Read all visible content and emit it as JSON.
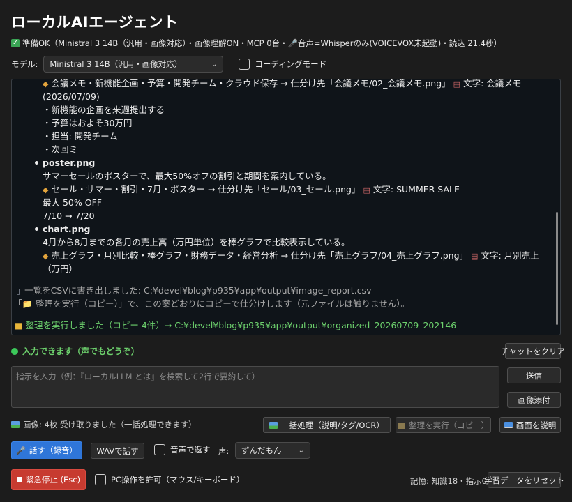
{
  "app": {
    "title": "ローカルAIエージェント",
    "status_text": "準備OK（Ministral 3 14B（汎用・画像対応）・画像理解ON・MCP 0台・🎤音声=Whisperのみ(VOICEVOX未起動)・読込 21.4秒）"
  },
  "model": {
    "label": "モデル:",
    "selected": "Ministral 3 14B（汎用・画像対応）",
    "coding_mode_label": "コーディングモード"
  },
  "chat": {
    "lines": [
      "会議メモ・新機能企画・予算・開発チーム・クラウド保存 → 仕分け先「会議メモ/02_会議メモ.png」",
      "文字: 会議メモ",
      "(2026/07/09)",
      "・新機能の企画を来週提出する",
      "・予算はおよそ30万円",
      "・担当: 開発チーム",
      "・次回ミ",
      "poster.png",
      "サマーセールのポスターで、最大50%オフの割引と期間を案内している。",
      "セール・サマー・割引・7月・ポスター → 仕分け先「セール/03_セール.png」",
      "文字: SUMMER SALE",
      "最大 50% OFF",
      "7/10 → 7/20",
      "chart.png",
      "4月から8月までの各月の売上高（万円単位）を棒グラフで比較表示している。",
      "売上グラフ・月別比較・棒グラフ・財務データ・経営分析 → 仕分け先「売上グラフ/04_売上グラフ.png」",
      "文字: 月別売上",
      "（万円）",
      "一覧をCSVに書き出しました: C:¥devel¥blog¥p935¥app¥output¥image_report.csv",
      "「📁 整理を実行（コピー）」で、この案どおりにコピーで仕分けします（元ファイルは触りません）。",
      "整理を実行しました（コピー 4件）→ C:¥devel¥blog¥p935¥app¥output¥organized_20260709_202146"
    ]
  },
  "status": {
    "ready": "入力できます（声でもどうぞ）",
    "images": "画像: 4枚 受け取りました（一括処理できます）",
    "memory": "記憶: 知識18・指示0"
  },
  "input": {
    "placeholder": "指示を入力（例：『ローカルLLM とは』を検索して2行で要約して）"
  },
  "buttons": {
    "clear_chat": "チャットをクリア",
    "send": "送信",
    "attach_image": "画像添付",
    "batch": "一括処理（説明/タグ/OCR）",
    "organize": "整理を実行（コピー）",
    "describe_screen": "画面を説明",
    "talk": "話す（録音）",
    "wav": "WAVで話す",
    "voice_reply": "音声で返す",
    "voice_label": "声:",
    "voice_selected": "ずんだもん",
    "emergency_stop": "緊急停止 (Esc)",
    "pc_control": "PC操作を許可（マウス/キーボード）",
    "reset_learning": "学習データをリセット"
  },
  "colors": {
    "accent_blue": "#2f76d9",
    "danger_red": "#c73b30",
    "ready_green": "#6dd16d",
    "background": "#1c1c1c"
  }
}
